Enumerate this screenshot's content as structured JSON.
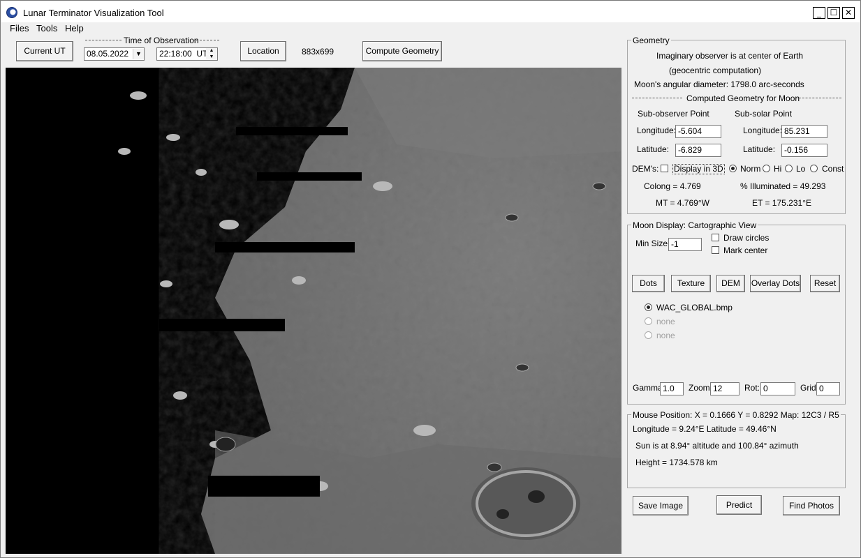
{
  "window": {
    "title": "Lunar Terminator Visualization Tool"
  },
  "menu": {
    "files": "Files",
    "tools": "Tools",
    "help": "Help"
  },
  "toolbar": {
    "current_ut": "Current UT",
    "time_group_label": "Time of Observation",
    "date_value": "08.05.2022",
    "time_value": "22:18:00",
    "time_suffix": "UT",
    "location": "Location",
    "image_size": "883x699",
    "compute_geometry": "Compute Geometry"
  },
  "geometry": {
    "group_label": "Geometry",
    "observer_line1": "Imaginary observer is at center of Earth",
    "observer_line2": "(geocentric computation)",
    "angular_diameter": "Moon's angular diameter: 1798.0 arc-seconds",
    "computed_label": "Computed Geometry for Moon",
    "sub_observer_label": "Sub-observer Point",
    "sub_solar_label": "Sub-solar Point",
    "longitude_label": "Longitude:",
    "latitude_label": "Latitude:",
    "sub_observer_longitude": "-5.604",
    "sub_observer_latitude": "-6.829",
    "sub_solar_longitude": "85.231",
    "sub_solar_latitude": "-0.156",
    "dems_label": "DEM's:",
    "display_3d": "Display in 3D",
    "dem_norm": "Norm",
    "dem_hi": "Hi",
    "dem_lo": "Lo",
    "dem_const": "Const",
    "colong": "Colong =  4.769",
    "illuminated": "% Illuminated = 49.293",
    "mt": "MT = 4.769°W",
    "et": "ET = 175.231°E"
  },
  "moon_display": {
    "group_label": "Moon Display:  Cartographic View",
    "min_size_label": "Min Size",
    "min_size_value": "-1",
    "draw_circles": "Draw circles",
    "mark_center": "Mark center",
    "btn_dots": "Dots",
    "btn_texture": "Texture",
    "btn_dem": "DEM",
    "btn_overlay_dots": "Overlay Dots",
    "btn_reset": "Reset",
    "texture1": "WAC_GLOBAL.bmp",
    "texture2": "none",
    "texture3": "none",
    "gamma_label": "Gamma:",
    "gamma_value": "1.0",
    "zoom_label": "Zoom:",
    "zoom_value": "12",
    "rot_label": "Rot:",
    "rot_value": "0",
    "grid_label": "Grid:",
    "grid_value": "0"
  },
  "mouse": {
    "group_label": "Mouse Position:  X = 0.1666  Y = 0.8292  Map: 12C3 / R5",
    "lonlat": "Longitude = 9.24°E   Latitude = 49.46°N",
    "sun": "Sun is at 8.94° altitude and 100.84° azimuth",
    "height": "Height = 1734.578 km"
  },
  "bottom_buttons": {
    "save_image": "Save Image",
    "predict": "Predict",
    "find_photos": "Find Photos"
  }
}
